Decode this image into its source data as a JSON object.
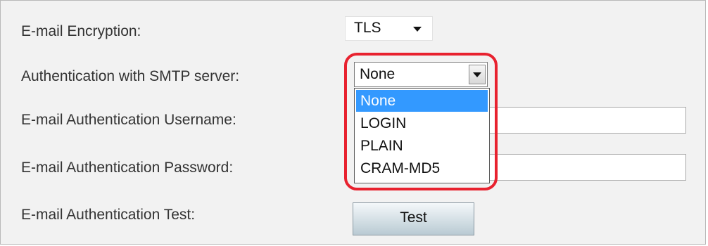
{
  "form": {
    "encryption": {
      "label": "E-mail Encryption:",
      "value": "TLS"
    },
    "authentication": {
      "label": "Authentication with SMTP server:",
      "value": "None",
      "options": [
        "None",
        "LOGIN",
        "PLAIN",
        "CRAM-MD5"
      ],
      "selected_index": 0
    },
    "username": {
      "label": "E-mail Authentication Username:",
      "value": ""
    },
    "password": {
      "label": "E-mail Authentication Password:",
      "value": ""
    },
    "test": {
      "label": "E-mail Authentication Test:",
      "button_label": "Test"
    }
  },
  "colors": {
    "panel_bg": "#f2f2f2",
    "highlight": "#e8222f",
    "selected_option_bg": "#3399ff"
  }
}
